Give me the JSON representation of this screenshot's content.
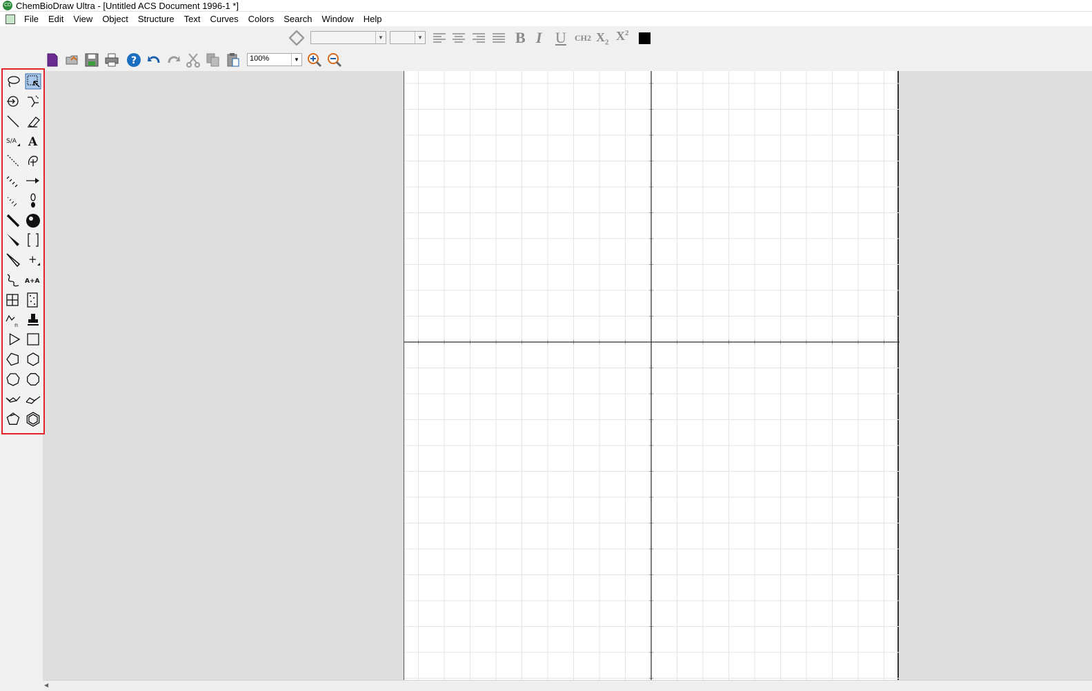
{
  "window": {
    "title": "ChemBioDraw Ultra - [Untitled ACS Document 1996-1 *]",
    "app_icon_label": "CD"
  },
  "menubar": {
    "items": [
      "File",
      "Edit",
      "View",
      "Object",
      "Structure",
      "Text",
      "Curves",
      "Colors",
      "Search",
      "Window",
      "Help"
    ]
  },
  "format_toolbar": {
    "font_value": "",
    "size_value": "",
    "bold": "B",
    "italic": "I",
    "underline": "U",
    "formula": "CH2",
    "subscript": "X2",
    "superscript": "X2",
    "color": "#000000"
  },
  "main_toolbar": {
    "zoom_value": "100%"
  },
  "palette": {
    "highlight_color": "#e0242a",
    "tools": [
      [
        "lasso-tool-icon",
        "marquee-tool-icon"
      ],
      [
        "structure-perspective-icon",
        "mass-fragmentation-icon"
      ],
      [
        "solid-bond-icon",
        "eraser-icon"
      ],
      [
        "stereochemistry-icon",
        "text-tool-icon"
      ],
      [
        "dashed-bond-icon",
        "template-tool-icon"
      ],
      [
        "hashed-bond-icon",
        "arrow-tool-icon"
      ],
      [
        "hashed-wedge-bond-icon",
        "orbital-tool-icon"
      ],
      [
        "bold-bond-icon",
        "drawing-elements-icon"
      ],
      [
        "wedged-bond-icon",
        "brackets-tool-icon"
      ],
      [
        "hollow-wedge-bond-icon",
        "chemical-symbols-icon"
      ],
      [
        "wavy-bond-icon",
        "query-tool-icon"
      ],
      [
        "table-tool-icon",
        "tlc-plate-icon"
      ],
      [
        "acyclic-chain-icon",
        "stamp-tool-icon"
      ],
      [
        "cyclopropane-icon",
        "cyclobutane-icon"
      ],
      [
        "cyclopentane-icon",
        "cyclohexane-icon"
      ],
      [
        "cycloheptane-icon",
        "cyclooctane-icon"
      ],
      [
        "cyclohexane-chair1-icon",
        "cyclohexane-chair2-icon"
      ],
      [
        "cyclopentadiene-icon",
        "benzene-icon"
      ]
    ]
  }
}
